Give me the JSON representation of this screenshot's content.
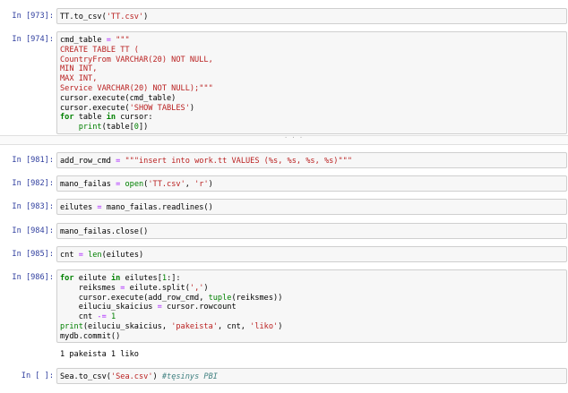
{
  "cells": [
    {
      "prompt": "In [973]:",
      "lines": [
        [
          "n",
          "TT.to_csv("
        ],
        [
          "s",
          "'TT.csv'"
        ],
        [
          "n",
          ")"
        ]
      ]
    },
    {
      "prompt": "In [974]:",
      "multiline": [
        [
          [
            "n",
            "cmd_table "
          ],
          [
            "o",
            "="
          ],
          [
            "n",
            " "
          ],
          [
            "s",
            "\"\"\""
          ]
        ],
        [
          [
            "s",
            "CREATE TABLE TT ("
          ]
        ],
        [
          [
            "s",
            "CountryFrom VARCHAR(20) NOT NULL,"
          ]
        ],
        [
          [
            "s",
            "MIN INT,"
          ]
        ],
        [
          [
            "s",
            "MAX INT,"
          ]
        ],
        [
          [
            "s",
            "Service VARCHAR(20) NOT NULL);\"\"\""
          ]
        ],
        [
          [
            "n",
            "cursor.execute(cmd_table)"
          ]
        ],
        [
          [
            "n",
            "cursor.execute("
          ],
          [
            "s",
            "'SHOW TABLES'"
          ],
          [
            "n",
            ")"
          ]
        ],
        [
          [
            "k",
            "for"
          ],
          [
            "n",
            " table "
          ],
          [
            "k",
            "in"
          ],
          [
            "n",
            " cursor:"
          ]
        ],
        [
          [
            "n",
            "    "
          ],
          [
            "b",
            "print"
          ],
          [
            "n",
            "(table["
          ],
          [
            "d",
            "0"
          ],
          [
            "n",
            "])"
          ]
        ]
      ]
    },
    {
      "prompt": "In [981]:",
      "lines": [
        [
          "n",
          "add_row_cmd "
        ],
        [
          "o",
          "="
        ],
        [
          "n",
          " "
        ],
        [
          "s",
          "\"\"\"insert into work.tt VALUES (%s, %s, %s, %s)\"\"\""
        ]
      ]
    },
    {
      "prompt": "In [982]:",
      "lines": [
        [
          "n",
          "mano_failas "
        ],
        [
          "o",
          "="
        ],
        [
          "n",
          " "
        ],
        [
          "b",
          "open"
        ],
        [
          "n",
          "("
        ],
        [
          "s",
          "'TT.csv'"
        ],
        [
          "n",
          ", "
        ],
        [
          "s",
          "'r'"
        ],
        [
          "n",
          ")"
        ]
      ]
    },
    {
      "prompt": "In [983]:",
      "lines": [
        [
          "n",
          "eilutes "
        ],
        [
          "o",
          "="
        ],
        [
          "n",
          " mano_failas.readlines()"
        ]
      ]
    },
    {
      "prompt": "In [984]:",
      "lines": [
        [
          "n",
          "mano_failas.close()"
        ]
      ]
    },
    {
      "prompt": "In [985]:",
      "lines": [
        [
          "n",
          "cnt "
        ],
        [
          "o",
          "="
        ],
        [
          "n",
          " "
        ],
        [
          "b",
          "len"
        ],
        [
          "n",
          "(eilutes)"
        ]
      ]
    },
    {
      "prompt": "In [986]:",
      "multiline": [
        [
          [
            "k",
            "for"
          ],
          [
            "n",
            " eilute "
          ],
          [
            "k",
            "in"
          ],
          [
            "n",
            " eilutes["
          ],
          [
            "d",
            "1"
          ],
          [
            "n",
            ":]:"
          ]
        ],
        [
          [
            "n",
            "    reiksmes "
          ],
          [
            "o",
            "="
          ],
          [
            "n",
            " eilute.split("
          ],
          [
            "s",
            "','"
          ],
          [
            "n",
            ")"
          ]
        ],
        [
          [
            "n",
            "    cursor.execute(add_row_cmd, "
          ],
          [
            "b",
            "tuple"
          ],
          [
            "n",
            "(reiksmes))"
          ]
        ],
        [
          [
            "n",
            "    eiluciu_skaicius "
          ],
          [
            "o",
            "="
          ],
          [
            "n",
            " cursor.rowcount"
          ]
        ],
        [
          [
            "n",
            "    cnt "
          ],
          [
            "o",
            "-="
          ],
          [
            "n",
            " "
          ],
          [
            "d",
            "1"
          ]
        ],
        [
          [
            "b",
            "print"
          ],
          [
            "n",
            "(eiluciu_skaicius, "
          ],
          [
            "s",
            "'pakeista'"
          ],
          [
            "n",
            ", cnt, "
          ],
          [
            "s",
            "'liko'"
          ],
          [
            "n",
            ")"
          ]
        ],
        [
          [
            "n",
            "mydb.commit()"
          ]
        ]
      ],
      "output": "1 pakeista 1 liko"
    },
    {
      "prompt": "In [ ]:",
      "lines": [
        [
          "n",
          "Sea.to_csv("
        ],
        [
          "s",
          "'Sea.csv'"
        ],
        [
          "n",
          ") "
        ],
        [
          "c",
          "#tęsinys PBI"
        ]
      ]
    }
  ],
  "collapsed_marker": "· · ·"
}
